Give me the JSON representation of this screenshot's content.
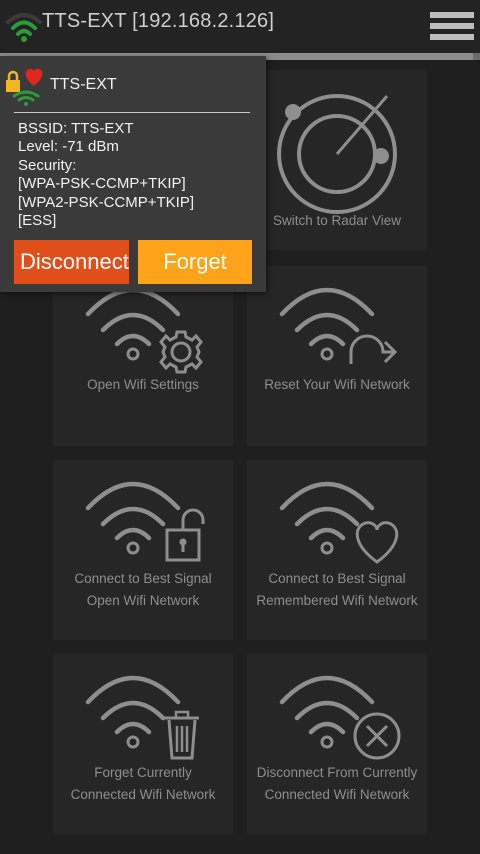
{
  "app_bar": {
    "title": "TTS-EXT [192.168.2.126]",
    "progress_fraction": 0.985
  },
  "tiles": [
    {
      "label_lines": [
        "Switch to Radar View"
      ],
      "icon": "radar-icon"
    },
    {
      "label_lines": [
        "Open Wifi Settings"
      ],
      "icon": "wifi-gear-icon"
    },
    {
      "label_lines": [
        "Reset Your Wifi Network"
      ],
      "icon": "wifi-reset-icon"
    },
    {
      "label_lines": [
        "Connect to Best Signal",
        "Open Wifi Network"
      ],
      "icon": "wifi-open-lock-icon"
    },
    {
      "label_lines": [
        "Connect to Best Signal",
        "Remembered Wifi Network"
      ],
      "icon": "wifi-heart-icon"
    },
    {
      "label_lines": [
        "Forget Currently",
        "Connected Wifi Network"
      ],
      "icon": "wifi-trash-icon"
    },
    {
      "label_lines": [
        "Disconnect From Currently",
        "Connected Wifi Network"
      ],
      "icon": "wifi-x-icon"
    }
  ],
  "popup": {
    "network_name": "TTS-EXT",
    "info_lines": [
      "BSSID: TTS-EXT",
      "Level: -71 dBm",
      "Security:",
      "[WPA-PSK-CCMP+TKIP]",
      "[WPA2-PSK-CCMP+TKIP]",
      "[ESS]"
    ],
    "disconnect_label": "Disconnect",
    "forget_label": "Forget"
  },
  "colors": {
    "disconnect": "#e04f1a",
    "forget": "#ffa31a",
    "wifi_signal": "#2a9d3a",
    "heart": "#e0271f",
    "lock": "#f2b71f"
  }
}
